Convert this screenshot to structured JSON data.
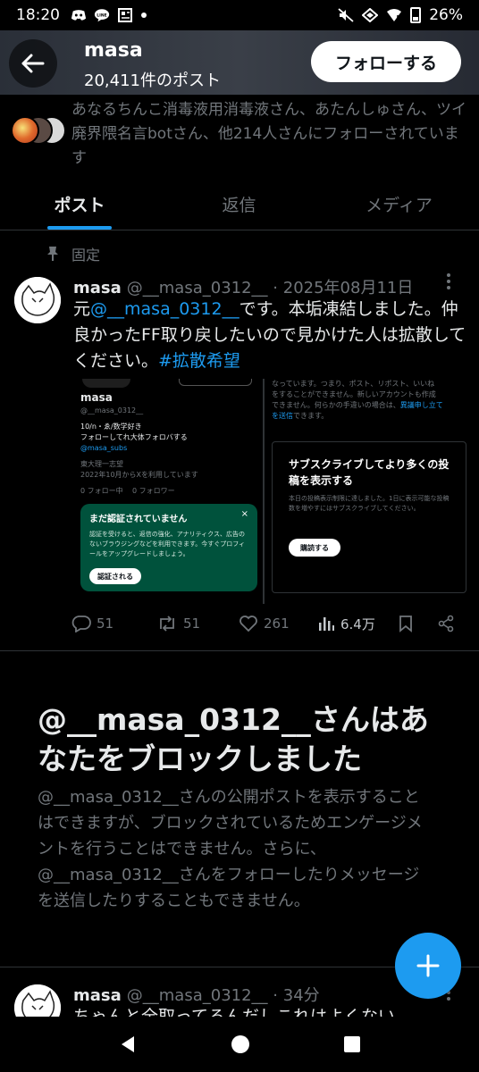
{
  "status_bar": {
    "time": "18:20",
    "left_icons": [
      "discord-icon",
      "line-icon",
      "news-icon",
      "dot-icon"
    ],
    "right_icons": [
      "mute-icon",
      "signal-icon",
      "wifi-icon",
      "battery-icon"
    ],
    "battery": "26%"
  },
  "header": {
    "name": "masa",
    "post_count": "20,411件のポスト",
    "follow_label": "フォローする"
  },
  "followed_by": {
    "text": "あなるちんこ消毒液用消毒液さん、あたんしゅさん、ツイ廃界隈名言botさん、他214人さんにフォローされています"
  },
  "tabs": [
    {
      "label": "ポスト",
      "active": true
    },
    {
      "label": "返信",
      "active": false
    },
    {
      "label": "メディア",
      "active": false
    }
  ],
  "pinned": {
    "label": "固定"
  },
  "tweet1": {
    "name": "masa",
    "handle": "@__masa_0312__",
    "sep": "·",
    "date": "2025年08月11日",
    "text_pre": "元",
    "mention": "@__masa_0312__",
    "text_mid": "です。本垢凍結しました。仲良かったFF取り戻したいので見かけた人は拡散してください。",
    "hashtag": "#拡散希望",
    "media": {
      "profile_name": "masa",
      "profile_handle": "@__masa_0312__",
      "bio1": "10/n・ゑ/数学好き",
      "bio2": "フォローしてれ大体フォロバする",
      "bio_link": "@masa_subs",
      "location": "東大理一志望",
      "joined": "2022年10月からXを利用しています",
      "following": "0 フォロー中",
      "followers": "0 フォロワー",
      "verify_title": "まだ認証されていません",
      "verify_desc": "認証を受けると、返信の強化、アナリティクス、広告のないブラウジングなどを利用できます。今すぐプロフィールをアップグレードしましょう。",
      "verify_btn": "認証される",
      "right_top1": "なっています。つまり、ポスト、リポスト、いいね",
      "right_top2": "をすることができません。新しいアカウントも作成",
      "right_top3": "できません。何らかの手違いの場合は、",
      "right_top_link1": "異議申し立て",
      "right_top_link2": "を送信",
      "right_top4": "できます。",
      "sub_title": "サブスクライブしてより多くの投稿を表示する",
      "sub_desc": "本日の投稿表示制限に達しました。1日に表示可能な投稿数を増やすにはサブスクライブしてください。",
      "sub_btn": "購読する"
    },
    "stats": {
      "replies": "51",
      "reposts": "51",
      "likes": "261",
      "views": "6.4万"
    }
  },
  "blocked": {
    "title": "@__masa_0312__さんはあなたをブロックしました",
    "description": "@__masa_0312__さんの公開ポストを表示することはできますが、ブロックされているためエンゲージメントを行うことはできません。さらに、@__masa_0312__さんをフォローしたりメッセージを送信したりすることもできません。"
  },
  "tweet2": {
    "name": "masa",
    "handle": "@__masa_0312__",
    "sep": "·",
    "time": "34分",
    "text": "ちゃんと全取ってるんだしこれはよくない"
  },
  "colors": {
    "accent": "#1d9bf0",
    "background": "#000000",
    "text": "#e7e9ea",
    "muted": "#71767b",
    "divider": "#2f3336",
    "verify_green": "#00523c"
  }
}
